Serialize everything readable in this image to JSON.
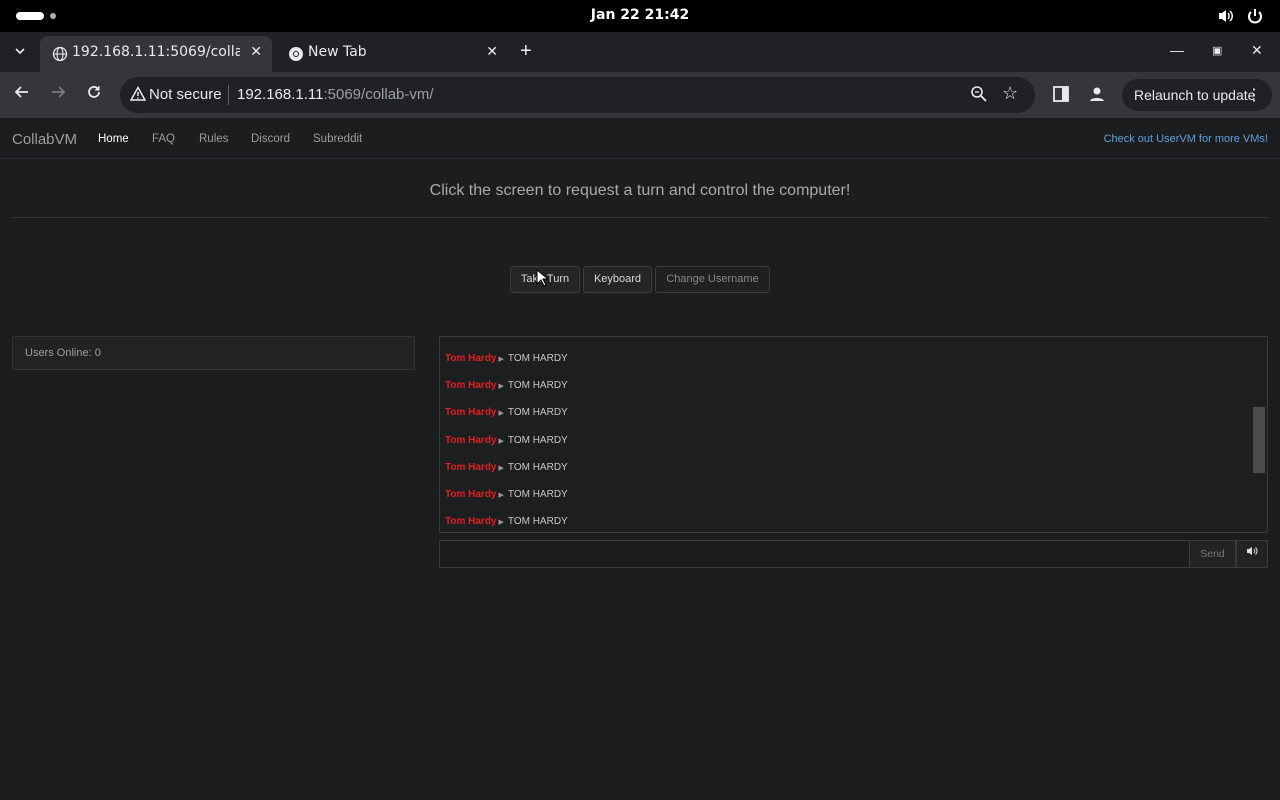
{
  "system_bar": {
    "clock": "Jan 22  21:42",
    "icons": [
      "volume-icon",
      "power-icon"
    ]
  },
  "browser": {
    "tabs": [
      {
        "title": "192.168.1.11:5069/collab-vm/",
        "active": true
      },
      {
        "title": "New Tab",
        "active": false
      }
    ],
    "security_label": "Not secure",
    "url_host": "192.168.1.11",
    "url_rest": ":5069/collab-vm/",
    "relaunch_label": "Relaunch to update"
  },
  "site": {
    "brand": "CollabVM",
    "nav": [
      "Home",
      "FAQ",
      "Rules",
      "Discord",
      "Subreddit"
    ],
    "active_nav": "Home",
    "promo": "Check out UserVM for more VMs!",
    "headline": "Click the screen to request a turn and control the computer!",
    "buttons": {
      "take_turn": "Take Turn",
      "keyboard": "Keyboard",
      "change_username": "Change Username"
    },
    "users_online": "Users Online: 0",
    "chat": {
      "messages": [
        {
          "user": "Tom Hardy",
          "text": "TOM HARDY"
        },
        {
          "user": "Tom Hardy",
          "text": "TOM HARDY"
        },
        {
          "user": "Tom Hardy",
          "text": "TOM HARDY"
        },
        {
          "user": "Tom Hardy",
          "text": "TOM HARDY"
        },
        {
          "user": "Tom Hardy",
          "text": "TOM HARDY"
        },
        {
          "user": "Tom Hardy",
          "text": "TOM HARDY"
        },
        {
          "user": "Tom Hardy",
          "text": "TOM HARDY"
        }
      ],
      "input_value": "",
      "send_label": "Send",
      "volume_icon": "speaker-icon"
    }
  }
}
